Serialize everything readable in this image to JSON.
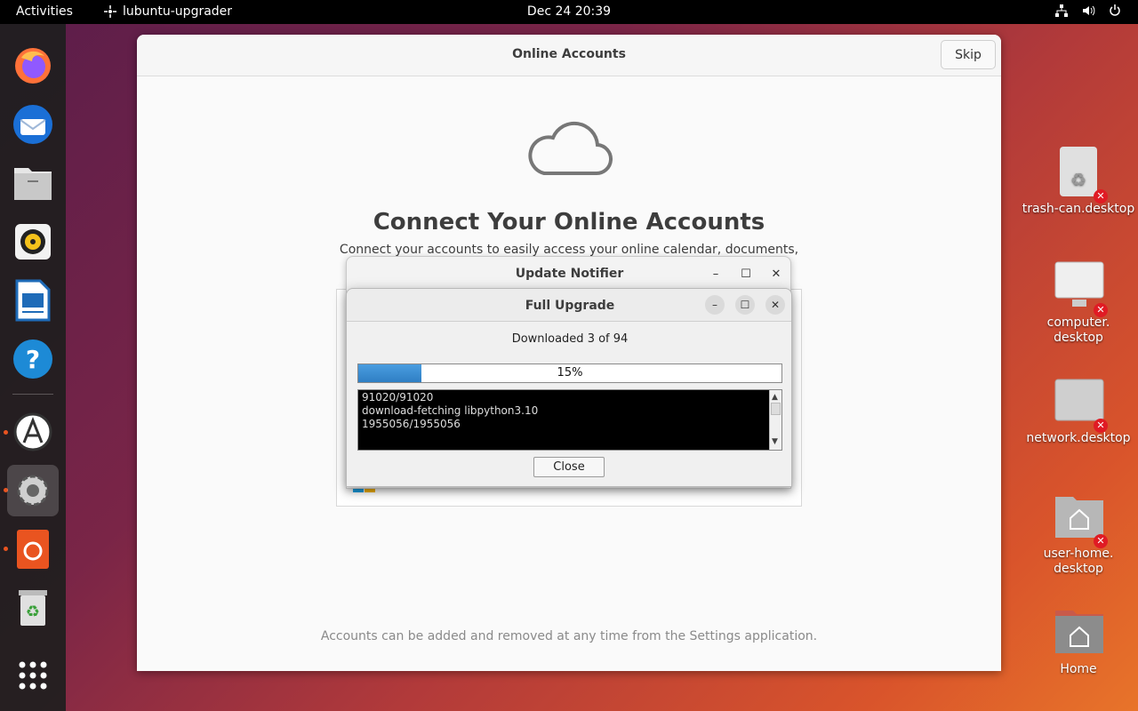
{
  "topbar": {
    "activities": "Activities",
    "app_name": "lubuntu-upgrader",
    "clock": "Dec 24  20:39"
  },
  "dock": {
    "items": [
      {
        "name": "firefox-icon"
      },
      {
        "name": "thunderbird-icon"
      },
      {
        "name": "files-icon"
      },
      {
        "name": "rhythmbox-icon"
      },
      {
        "name": "writer-icon"
      },
      {
        "name": "help-icon"
      },
      {
        "name": "software-updater-icon"
      },
      {
        "name": "settings-icon"
      },
      {
        "name": "ubuntu-software-icon"
      },
      {
        "name": "trash-icon"
      },
      {
        "name": "show-apps-icon"
      }
    ]
  },
  "main_window": {
    "title": "Online Accounts",
    "skip": "Skip",
    "heading": "Connect Your Online Accounts",
    "subheading": "Connect your accounts to easily access your online calendar, documents,",
    "footer": "Accounts can be added and removed at any time from the Settings application."
  },
  "notifier": {
    "title": "Update Notifier"
  },
  "upgrade": {
    "title": "Full Upgrade",
    "status": "Downloaded 3 of 94",
    "progress": 0.15,
    "progress_label": "15%",
    "log_lines": [
      "91020/91020",
      "download-fetching libpython3.10",
      "1955056/1955056"
    ],
    "close": "Close"
  },
  "desktop": {
    "icons": [
      {
        "label": "trash-can.desktop"
      },
      {
        "label": "computer.\ndesktop"
      },
      {
        "label": "network.desktop"
      },
      {
        "label": "user-home.\ndesktop"
      },
      {
        "label": "Home"
      }
    ]
  },
  "colors": {
    "accent": "#e95420",
    "progress": "#3a8fd6"
  }
}
